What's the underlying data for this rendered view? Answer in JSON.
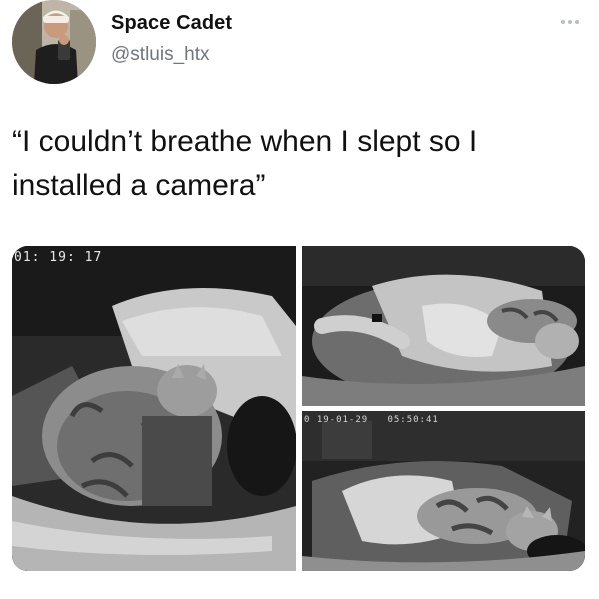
{
  "tweet": {
    "author": {
      "display_name": "Space Cadet",
      "handle": "@stluis_htx"
    },
    "text": "“I couldn’t breathe when I slept so I\ninstalled a camera”",
    "menu_icon": "more-horizontal-icon"
  },
  "media": {
    "photos": [
      {
        "subject": "night vision camera: cat on sleeping man",
        "timestamp": "01: 19: 17"
      },
      {
        "subject": "night vision camera: cat lying on sleeper"
      },
      {
        "subject": "night vision camera: cat sprawled on blanket",
        "timestamp": "0 19-01-29   05:50:41"
      }
    ]
  },
  "colors": {
    "text": "#111111",
    "secondary_text": "#6e767d",
    "icon": "#b9bec3"
  }
}
